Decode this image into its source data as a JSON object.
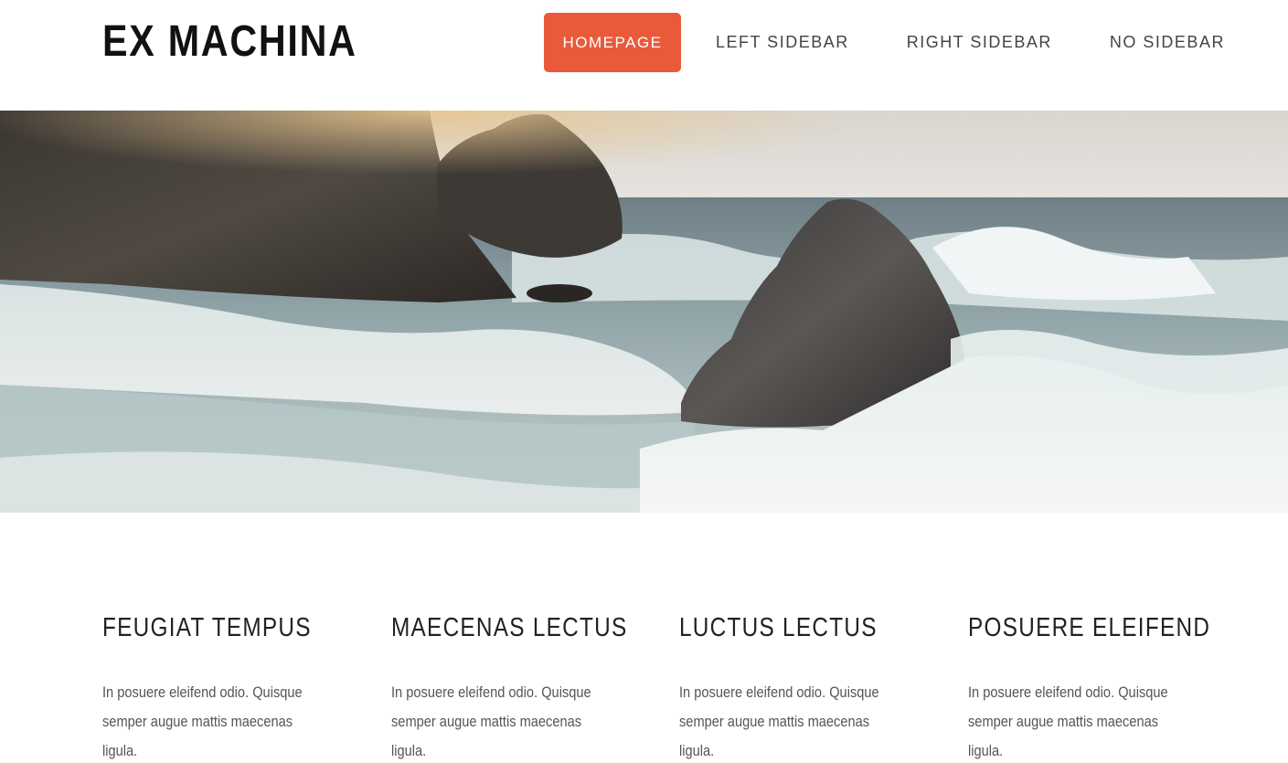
{
  "header": {
    "logo": "EX MACHINA",
    "nav": [
      {
        "label": "HOMEPAGE",
        "active": true
      },
      {
        "label": "LEFT SIDEBAR",
        "active": false
      },
      {
        "label": "RIGHT SIDEBAR",
        "active": false
      },
      {
        "label": "NO SIDEBAR",
        "active": false
      }
    ]
  },
  "hero": {
    "image": "rocky-coast-waves-photo"
  },
  "features": [
    {
      "title": "FEUGIAT TEMPUS",
      "text": "In posuere eleifend odio. Quisque semper augue mattis maecenas ligula."
    },
    {
      "title": "MAECENAS LECTUS",
      "text": "In posuere eleifend odio. Quisque semper augue mattis maecenas ligula."
    },
    {
      "title": "LUCTUS LECTUS",
      "text": "In posuere eleifend odio. Quisque semper augue mattis maecenas ligula."
    },
    {
      "title": "POSUERE ELEIFEND",
      "text": "In posuere eleifend odio. Quisque semper augue mattis maecenas ligula."
    }
  ],
  "colors": {
    "accent": "#e95a3a",
    "text_dark": "#111111",
    "text_body": "#555555"
  }
}
